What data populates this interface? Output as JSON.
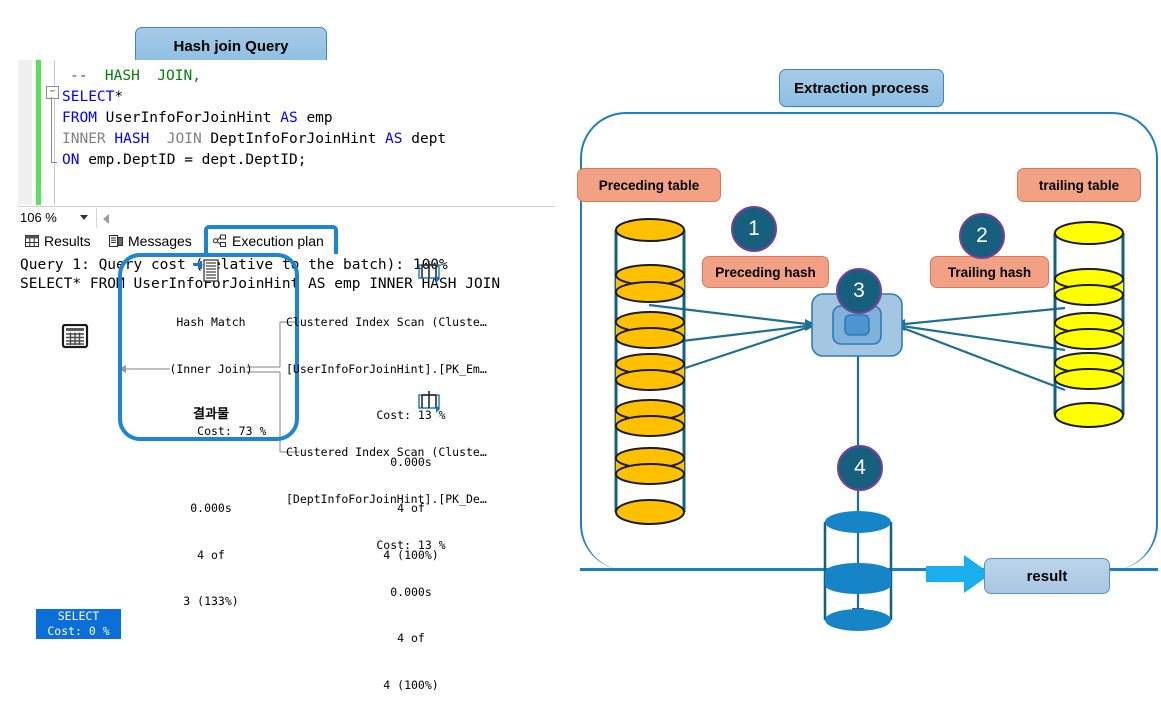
{
  "left_panel": {
    "title_callout": "Hash join Query",
    "code_lines": [
      {
        "id": "l1",
        "segments": [
          {
            "t": "--  HASH  JOIN,",
            "c": "cmt"
          }
        ]
      },
      {
        "id": "l2",
        "segments": [
          {
            "t": "SELECT",
            "c": "kw"
          },
          {
            "t": "*",
            "c": "plain"
          }
        ]
      },
      {
        "id": "l3",
        "segments": [
          {
            "t": "FROM",
            "c": "kw"
          },
          {
            "t": " UserInfoForJoinHint ",
            "c": "plain"
          },
          {
            "t": "AS",
            "c": "kw"
          },
          {
            "t": " emp",
            "c": "plain"
          }
        ]
      },
      {
        "id": "l4",
        "segments": [
          {
            "t": "INNER ",
            "c": "grey"
          },
          {
            "t": "HASH",
            "c": "kw"
          },
          {
            "t": "  JOIN",
            "c": "grey"
          },
          {
            "t": " DeptInfoForJoinHint ",
            "c": "plain"
          },
          {
            "t": "AS",
            "c": "kw"
          },
          {
            "t": " dept",
            "c": "plain"
          }
        ]
      },
      {
        "id": "l5",
        "segments": [
          {
            "t": "ON",
            "c": "kw"
          },
          {
            "t": " emp.DeptID = dept.DeptID;",
            "c": "plain"
          }
        ]
      }
    ],
    "collapse_glyph": "−",
    "zoom": {
      "value": "106 %",
      "caret": "dropdown-caret"
    },
    "tabs": [
      {
        "name": "results",
        "label": "Results",
        "icon": "grid-icon",
        "selected": false
      },
      {
        "name": "messages",
        "label": "Messages",
        "icon": "messages-icon",
        "selected": false
      },
      {
        "name": "execution-plan",
        "label": "Execution plan",
        "icon": "plan-icon",
        "selected": true
      }
    ],
    "plan_header_lines": [
      "Query 1: Query cost (relative to the batch): 100%",
      "SELECT* FROM UserInfoForJoinHint AS emp INNER HASH JOIN"
    ],
    "nodes": {
      "select": {
        "title": "SELECT",
        "cost": "Cost: 0 %",
        "icon": "select-result-icon"
      },
      "hash_match": {
        "icon": "hash-match-icon",
        "line1": "Hash Match",
        "line2": "(Inner Join)",
        "line3": "Cost: 73 %",
        "overlay": "결과물",
        "line4": "0.000s",
        "line5": "4 of",
        "line6": "3 (133%)"
      },
      "scan_top": {
        "icon": "clustered-index-scan-icon",
        "line1": "Clustered Index Scan (Cluste…",
        "line2": "[UserInfoForJoinHint].[PK_Em…",
        "line3": "Cost: 13 %",
        "line4": "0.000s",
        "line5": "4 of",
        "line6": "4 (100%)"
      },
      "scan_bottom": {
        "icon": "clustered-index-scan-icon",
        "line1": "Clustered Index Scan (Cluste…",
        "line2": "[DeptInfoForJoinHint].[PK_De…",
        "line3": "Cost: 13 %",
        "line4": "0.000s",
        "line5": "4 of",
        "line6": "4 (100%)"
      }
    }
  },
  "right_panel": {
    "title_callout": "Extraction process",
    "tags": {
      "preceding_table": "Preceding table",
      "trailing_table": "trailing table",
      "preceding_hash": "Preceding hash",
      "trailing_hash": "Trailing hash"
    },
    "badges": [
      "1",
      "2",
      "3",
      "4"
    ],
    "result_label": "result",
    "cylinders": {
      "preceding": {
        "name": "preceding-table-cylinder",
        "color": "#ffc000",
        "discs": 5
      },
      "trailing": {
        "name": "trailing-table-cylinder",
        "color": "#ffff00",
        "discs": 3
      },
      "result": {
        "name": "result-cylinder",
        "color": "#1585c8",
        "discs": 1
      }
    },
    "hash_box_name": "hash-bucket-box",
    "arrow_to_result": "right-arrow-icon"
  },
  "colors": {
    "callout_blue": "#8dbfe2",
    "tag_orange": "#f2a184",
    "badge_teal": "#16607e",
    "badge_ring_purple": "#7b3f98",
    "frame_blue": "#1b7fc4",
    "select_node_blue": "#0a6fd8",
    "arrow_cyan": "#18b0ea",
    "highlight_ring": "#1c86d6"
  }
}
